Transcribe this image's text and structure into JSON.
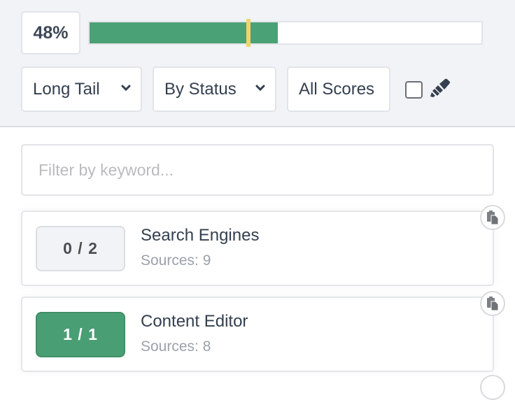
{
  "progress": {
    "label": "48%",
    "fill_fraction": 0.48,
    "marker_fraction": 0.4,
    "fill_color": "#4aa175",
    "marker_color": "#f2d36b"
  },
  "filters": {
    "dropdowns": [
      {
        "label": "Long Tail",
        "has_chevron": true
      },
      {
        "label": "By Status",
        "has_chevron": true
      },
      {
        "label": "All Scores",
        "has_chevron": false
      }
    ],
    "checkbox_checked": false,
    "highlighter_icon": "highlighter-icon"
  },
  "search": {
    "placeholder": "Filter by keyword...",
    "value": ""
  },
  "items": [
    {
      "score": "0 / 2",
      "status": "incomplete",
      "title": "Search Engines",
      "sources": "Sources: 9",
      "action_icon": "copy-icon"
    },
    {
      "score": "1 / 1",
      "status": "complete",
      "title": "Content Editor",
      "sources": "Sources: 8",
      "action_icon": "copy-icon"
    }
  ]
}
